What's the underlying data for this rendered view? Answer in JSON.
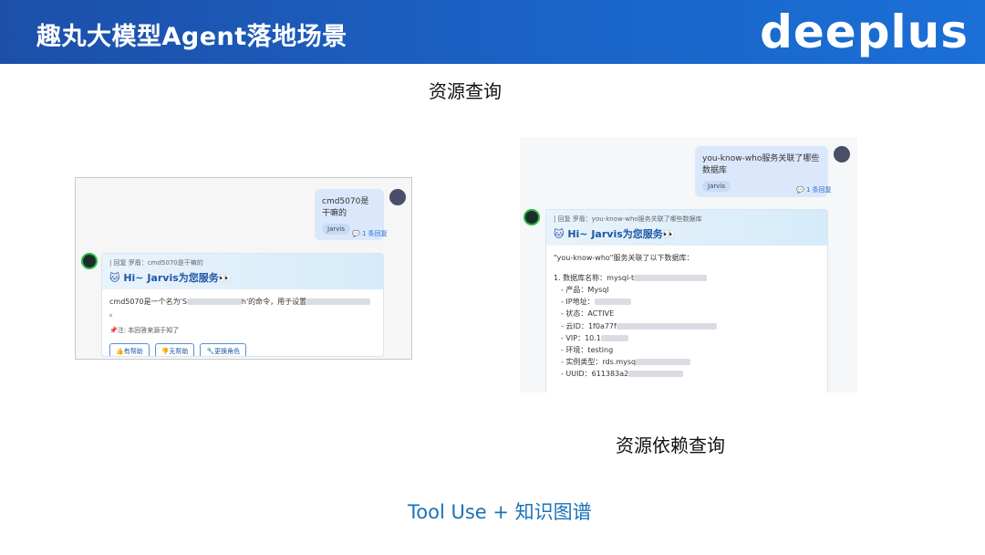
{
  "header": {
    "title": "趣丸大模型Agent落地场景",
    "brand": "deeplus"
  },
  "captions": {
    "top": "资源查询",
    "bottom": "资源依赖查询",
    "footer": "Tool Use + 知识图谱"
  },
  "left_panel": {
    "user_message": "cmd5070是干嘛的",
    "user_tag": "Jarvis",
    "reply_count": "1 条回复",
    "quote": "| 回复 罗裔：cmd5070是干嘛的",
    "card_title": "Hi~ Jarvis为您服务👀",
    "body_prefix": "cmd5070是一个名为'S",
    "body_mid": "h'的命令，用于设置",
    "body_suffix": "。",
    "note": "📌注: 本回答来源于知了",
    "buttons": [
      "👍有帮助",
      "👎无帮助",
      "🔧更换角色"
    ]
  },
  "right_panel": {
    "user_message": "you-know-who服务关联了哪些数据库",
    "user_tag": "Jarvis",
    "reply_count": "1 条回复",
    "quote": "| 回复 罗裔：you-know-who服务关联了哪些数据库",
    "card_title": "Hi~ Jarvis为您服务👀",
    "intro": "\"you-know-who\"服务关联了以下数据库：",
    "items": [
      "1. 数据库名称：mysql-t",
      "- 产品：Mysql",
      "- IP地址：",
      "- 状态：ACTIVE",
      "- 云ID：1f0a77f",
      "- VIP：10.1",
      "- 环境：testing",
      "- 实例类型：rds.mysq",
      "- UUID：611383a2"
    ]
  }
}
